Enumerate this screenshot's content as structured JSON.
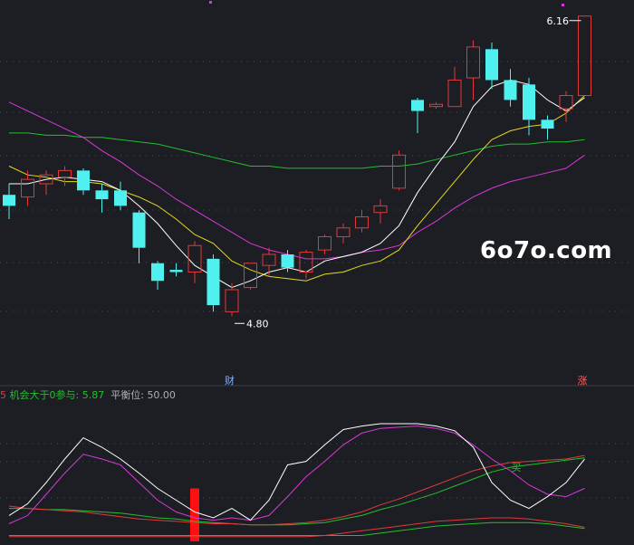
{
  "watermark": "6o7o.com",
  "info_bar": {
    "prefix": "5",
    "label1": "机会大于0参与:",
    "value1": "5.87",
    "label2": "平衡位:",
    "value2": "50.00"
  },
  "colors": {
    "background": "#1c1e24",
    "up_candle": "#e03a3a",
    "down_candle": "#4ef0f0",
    "ma_white": "#ffffff",
    "ma_yellow": "#e6d91e",
    "ma_magenta": "#d838d8",
    "ma_green": "#22c02c",
    "osc_white": "#ffffff",
    "osc_magenta": "#d838d8",
    "osc_red": "#e03a3a",
    "osc_green": "#22c02c",
    "bar_red": "#ff1010",
    "grid": "#454a55"
  },
  "chart_data": {
    "type": "candlestick",
    "price_range": [
      4.6,
      6.2
    ],
    "candles": [
      {
        "o": 5.35,
        "h": 5.4,
        "l": 5.24,
        "c": 5.3
      },
      {
        "o": 5.34,
        "h": 5.46,
        "l": 5.3,
        "c": 5.42
      },
      {
        "o": 5.4,
        "h": 5.46,
        "l": 5.35,
        "c": 5.44
      },
      {
        "o": 5.43,
        "h": 5.48,
        "l": 5.39,
        "c": 5.46
      },
      {
        "o": 5.46,
        "h": 5.47,
        "l": 5.35,
        "c": 5.37
      },
      {
        "o": 5.37,
        "h": 5.4,
        "l": 5.27,
        "c": 5.33
      },
      {
        "o": 5.37,
        "h": 5.41,
        "l": 5.28,
        "c": 5.3
      },
      {
        "o": 5.27,
        "h": 5.28,
        "l": 5.04,
        "c": 5.11
      },
      {
        "o": 5.04,
        "h": 5.05,
        "l": 4.92,
        "c": 4.96
      },
      {
        "o": 5.01,
        "h": 5.04,
        "l": 4.98,
        "c": 5.0
      },
      {
        "o": 5.0,
        "h": 5.14,
        "l": 4.95,
        "c": 5.12
      },
      {
        "o": 5.06,
        "h": 5.08,
        "l": 4.82,
        "c": 4.85
      },
      {
        "o": 4.82,
        "h": 4.95,
        "l": 4.8,
        "c": 4.92
      },
      {
        "o": 4.93,
        "h": 5.04,
        "l": 4.92,
        "c": 5.04
      },
      {
        "o": 5.03,
        "h": 5.11,
        "l": 4.98,
        "c": 5.08
      },
      {
        "o": 5.08,
        "h": 5.1,
        "l": 5.0,
        "c": 5.02
      },
      {
        "o": 5.0,
        "h": 5.1,
        "l": 4.97,
        "c": 5.09
      },
      {
        "o": 5.1,
        "h": 5.17,
        "l": 5.08,
        "c": 5.16
      },
      {
        "o": 5.16,
        "h": 5.22,
        "l": 5.13,
        "c": 5.2
      },
      {
        "o": 5.2,
        "h": 5.28,
        "l": 5.18,
        "c": 5.25
      },
      {
        "o": 5.27,
        "h": 5.33,
        "l": 5.22,
        "c": 5.3
      },
      {
        "o": 5.38,
        "h": 5.55,
        "l": 5.37,
        "c": 5.53
      },
      {
        "o": 5.78,
        "h": 5.79,
        "l": 5.63,
        "c": 5.73
      },
      {
        "o": 5.75,
        "h": 5.77,
        "l": 5.74,
        "c": 5.76
      },
      {
        "o": 5.75,
        "h": 5.93,
        "l": 5.75,
        "c": 5.87
      },
      {
        "o": 5.88,
        "h": 6.05,
        "l": 5.78,
        "c": 6.02
      },
      {
        "o": 6.01,
        "h": 6.04,
        "l": 5.83,
        "c": 5.87
      },
      {
        "o": 5.87,
        "h": 5.92,
        "l": 5.75,
        "c": 5.78
      },
      {
        "o": 5.85,
        "h": 5.88,
        "l": 5.62,
        "c": 5.69
      },
      {
        "o": 5.69,
        "h": 5.71,
        "l": 5.6,
        "c": 5.65
      },
      {
        "o": 5.74,
        "h": 5.82,
        "l": 5.68,
        "c": 5.8
      },
      {
        "o": 5.8,
        "h": 6.16,
        "l": 5.8,
        "c": 6.16
      }
    ],
    "ma_white": [
      5.4,
      5.4,
      5.42,
      5.43,
      5.42,
      5.41,
      5.37,
      5.3,
      5.22,
      5.12,
      5.03,
      4.98,
      4.93,
      4.96,
      5.0,
      5.02,
      5.0,
      5.05,
      5.07,
      5.09,
      5.13,
      5.21,
      5.36,
      5.48,
      5.59,
      5.75,
      5.84,
      5.87,
      5.85,
      5.78,
      5.73,
      5.79
    ],
    "ma_yellow": [
      5.48,
      5.44,
      5.43,
      5.41,
      5.41,
      5.4,
      5.37,
      5.34,
      5.3,
      5.24,
      5.17,
      5.13,
      5.05,
      5.01,
      4.98,
      4.97,
      4.96,
      4.99,
      5.0,
      5.03,
      5.05,
      5.1,
      5.21,
      5.31,
      5.41,
      5.51,
      5.6,
      5.64,
      5.66,
      5.67,
      5.72,
      5.8
    ],
    "ma_magenta": [
      5.77,
      5.73,
      5.69,
      5.65,
      5.61,
      5.55,
      5.5,
      5.44,
      5.39,
      5.33,
      5.28,
      5.23,
      5.18,
      5.13,
      5.1,
      5.08,
      5.06,
      5.06,
      5.07,
      5.09,
      5.1,
      5.12,
      5.18,
      5.23,
      5.29,
      5.34,
      5.38,
      5.41,
      5.43,
      5.45,
      5.47,
      5.53
    ],
    "ma_green": [
      5.63,
      5.63,
      5.62,
      5.62,
      5.61,
      5.61,
      5.6,
      5.59,
      5.58,
      5.56,
      5.54,
      5.52,
      5.5,
      5.48,
      5.48,
      5.47,
      5.47,
      5.47,
      5.47,
      5.47,
      5.48,
      5.48,
      5.49,
      5.51,
      5.53,
      5.55,
      5.57,
      5.58,
      5.58,
      5.59,
      5.59,
      5.6
    ],
    "annotations": {
      "high_label": "6.16",
      "low_label": "4.80",
      "tag_low": "财",
      "tag_high": "涨"
    },
    "oscillator": {
      "range": [
        0,
        100
      ],
      "white": [
        12,
        22,
        40,
        60,
        78,
        70,
        60,
        48,
        35,
        25,
        15,
        10,
        18,
        8,
        25,
        55,
        58,
        72,
        85,
        88,
        90,
        90,
        90,
        88,
        84,
        70,
        40,
        25,
        18,
        28,
        40,
        60
      ],
      "magenta": [
        5,
        12,
        30,
        48,
        64,
        60,
        55,
        40,
        25,
        15,
        10,
        8,
        10,
        8,
        12,
        28,
        45,
        58,
        72,
        82,
        86,
        87,
        88,
        86,
        82,
        72,
        60,
        50,
        38,
        30,
        28,
        35
      ],
      "red": [
        20,
        18,
        17,
        16,
        15,
        13,
        11,
        9,
        8,
        7,
        6,
        5,
        5,
        4,
        4,
        5,
        6,
        8,
        11,
        15,
        21,
        26,
        32,
        38,
        44,
        50,
        54,
        57,
        58,
        59,
        60,
        63
      ],
      "green": [
        18,
        18,
        17,
        17,
        16,
        15,
        14,
        12,
        10,
        9,
        7,
        6,
        5,
        4,
        4,
        4,
        5,
        6,
        9,
        12,
        17,
        21,
        26,
        31,
        37,
        43,
        49,
        53,
        55,
        57,
        59,
        61
      ],
      "red_lower": [
        -6,
        -6,
        -6,
        -6,
        -6,
        -6,
        -6,
        -6,
        -6,
        -6,
        -6,
        -6,
        -6,
        -6,
        -6,
        -6,
        -6,
        -5,
        -3,
        -1,
        1,
        3,
        5,
        7,
        8,
        9,
        10,
        10,
        9,
        7,
        5,
        2
      ],
      "green_lower": [
        -5,
        -5,
        -5,
        -5,
        -5,
        -5,
        -5,
        -5,
        -5,
        -5,
        -5,
        -5,
        -5,
        -5,
        -5,
        -5,
        -5,
        -5,
        -5,
        -5,
        -3,
        -1,
        1,
        3,
        4,
        5,
        6,
        6,
        6,
        5,
        3,
        1
      ],
      "red_bar_index": 10,
      "red_bar_value": 35,
      "label": "买"
    }
  }
}
